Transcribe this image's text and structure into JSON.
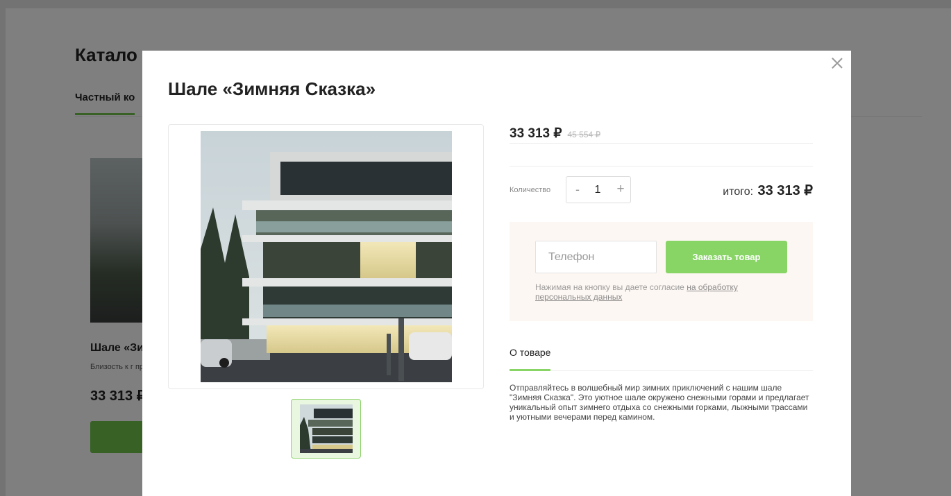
{
  "background": {
    "catalog_title": "Катало",
    "tab_active": "Частный ко",
    "card": {
      "title": "Шале «Зи",
      "desc": "Близость к г приватная с оборудовани гостиная с к",
      "price": "33 313 ₽"
    }
  },
  "modal": {
    "title": "Шале «Зимняя Сказка»",
    "price": "33 313 ₽",
    "old_price": "45 554 ₽",
    "quantity_label": "Количество",
    "quantity_minus": "-",
    "quantity_value": "1",
    "quantity_plus": "+",
    "total_label": "итого:",
    "total_value": "33 313 ₽",
    "phone_placeholder": "Телефон",
    "order_button": "Заказать товар",
    "consent_text": "Нажимая на кнопку вы даете согласие ",
    "consent_link": "на обработку персональных данных",
    "about_tab": "О товаре",
    "about_text": "Отправляйтесь в волшебный мир зимних приключений с нашим шале \"Зимняя Сказка\". Это уютное шале окружено снежными горами и предлагает уникальный опыт зимнего отдыха со снежными горками, лыжными трассами и уютными вечерами перед камином."
  },
  "colors": {
    "accent": "#88d566",
    "accent_dark": "#6ec34a",
    "order_box_bg": "#fdf7f3"
  }
}
